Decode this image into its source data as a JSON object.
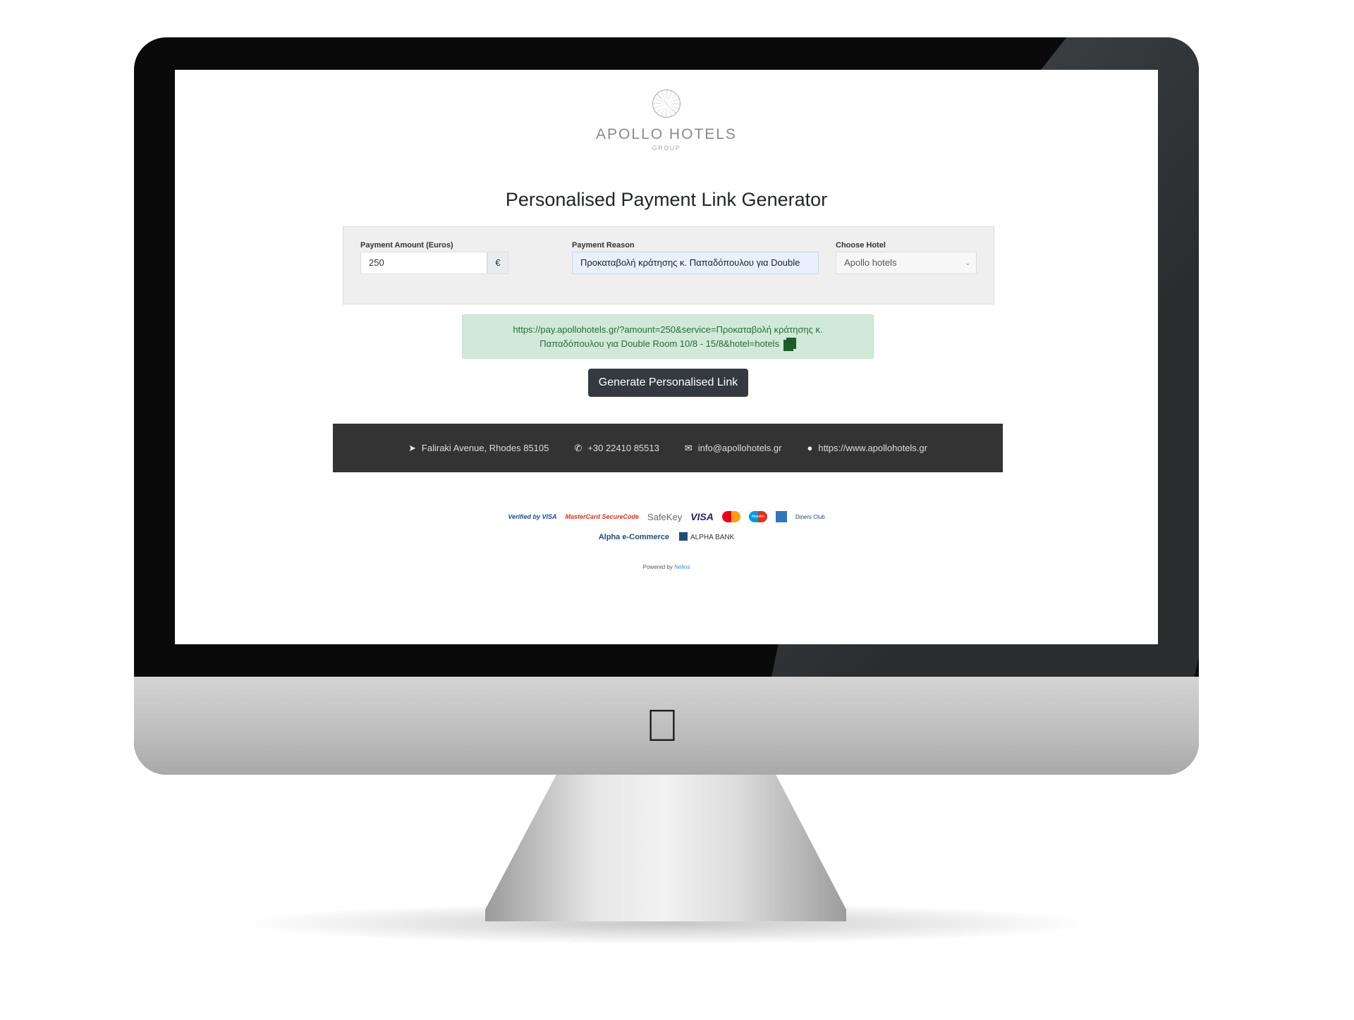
{
  "logo": {
    "name": "APOLLO HOTELS",
    "sub": "GROUP"
  },
  "title": "Personalised Payment Link Generator",
  "form": {
    "amount_label": "Payment Amount (Euros)",
    "amount_value": "250",
    "currency": "€",
    "reason_label": "Payment Reason",
    "reason_value": "Προκαταβολή κράτησης κ. Παπαδόπουλου για Double",
    "hotel_label": "Choose Hotel",
    "hotel_value": "Apollo hotels"
  },
  "result": {
    "link_line1": "https://pay.apollohotels.gr/?amount=250&service=Προκαταβολή κράτησης κ.",
    "link_line2": "Παπαδόπουλου για Double Room 10/8 - 15/8&hotel=hotels"
  },
  "generate_label": "Generate Personalised Link",
  "footer": {
    "address": "Faliraki Avenue, Rhodes 85105",
    "phone": "+30 22410 85513",
    "email": "info@apollohotels.gr",
    "website": "https://www.apollohotels.gr"
  },
  "cards": [
    "Verified by VISA",
    "MasterCard SecureCode",
    "SafeKey",
    "VISA",
    "MasterCard",
    "Maestro",
    "AMEX",
    "Diners Club"
  ],
  "bank": {
    "ecommerce": "Alpha e-Commerce",
    "bank": "ALPHA BANK"
  },
  "powered": {
    "prefix": "Powered by",
    "brand": "Nelios"
  }
}
